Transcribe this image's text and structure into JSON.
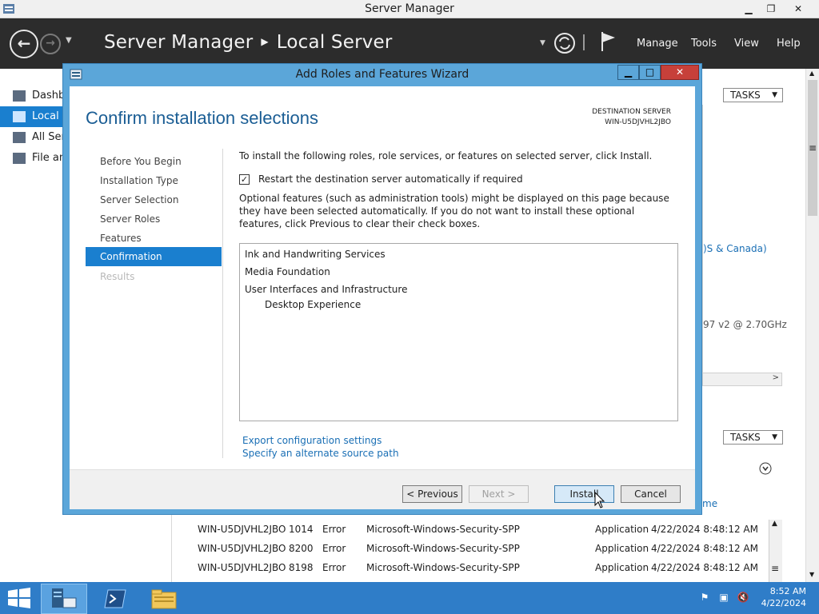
{
  "window": {
    "title": "Server Manager"
  },
  "header": {
    "breadcrumb_app": "Server Manager",
    "breadcrumb_page": "Local Server",
    "menu": [
      "Manage",
      "Tools",
      "View",
      "Help"
    ]
  },
  "sidebar": {
    "items": [
      {
        "label": "Dashb"
      },
      {
        "label": "Local S"
      },
      {
        "label": "All Ser"
      },
      {
        "label": "File an"
      }
    ]
  },
  "background": {
    "tasks_label": "TASKS",
    "timezone_fragment": ")S & Canada)",
    "cpu_fragment": "97 v2 @ 2.70GHz",
    "events_link_fragment": "me",
    "events": [
      {
        "server": "WIN-U5DJVHL2JBO",
        "id": "1014",
        "severity": "Error",
        "source": "Microsoft-Windows-Security-SPP",
        "log": "Application",
        "date": "4/22/2024 8:48:12 AM"
      },
      {
        "server": "WIN-U5DJVHL2JBO",
        "id": "8200",
        "severity": "Error",
        "source": "Microsoft-Windows-Security-SPP",
        "log": "Application",
        "date": "4/22/2024 8:48:12 AM"
      },
      {
        "server": "WIN-U5DJVHL2JBO",
        "id": "8198",
        "severity": "Error",
        "source": "Microsoft-Windows-Security-SPP",
        "log": "Application",
        "date": "4/22/2024 8:48:12 AM"
      }
    ]
  },
  "wizard": {
    "title": "Add Roles and Features Wizard",
    "heading": "Confirm installation selections",
    "dest_label": "DESTINATION SERVER",
    "dest_server": "WIN-U5DJVHL2JBO",
    "steps": [
      {
        "label": "Before You Begin",
        "state": "normal"
      },
      {
        "label": "Installation Type",
        "state": "normal"
      },
      {
        "label": "Server Selection",
        "state": "normal"
      },
      {
        "label": "Server Roles",
        "state": "normal"
      },
      {
        "label": "Features",
        "state": "normal"
      },
      {
        "label": "Confirmation",
        "state": "active"
      },
      {
        "label": "Results",
        "state": "disabled"
      }
    ],
    "instruction": "To install the following roles, role services, or features on selected server, click Install.",
    "restart_label": "Restart the destination server automatically if required",
    "restart_checked": true,
    "optional_text": "Optional features (such as administration tools) might be displayed on this page because they have been selected automatically. If you do not want to install these optional features, click Previous to clear their check boxes.",
    "selections": [
      {
        "label": "Ink and Handwriting Services",
        "indent": 0
      },
      {
        "label": "Media Foundation",
        "indent": 0
      },
      {
        "label": "User Interfaces and Infrastructure",
        "indent": 0
      },
      {
        "label": "Desktop Experience",
        "indent": 1
      }
    ],
    "export_link": "Export configuration settings",
    "alt_source_link": "Specify an alternate source path",
    "buttons": {
      "previous": "< Previous",
      "next": "Next >",
      "install": "Install",
      "cancel": "Cancel"
    }
  },
  "taskbar": {
    "time": "8:52 AM",
    "date": "4/22/2024"
  }
}
